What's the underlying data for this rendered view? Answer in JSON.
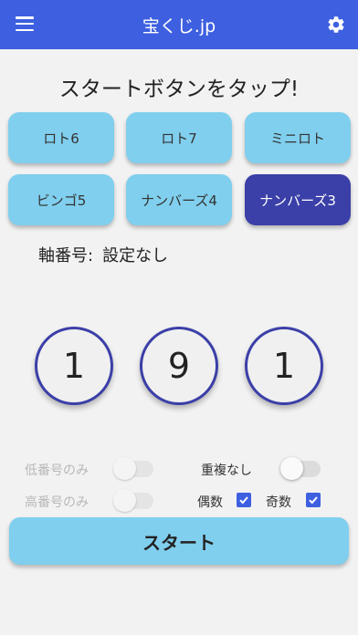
{
  "appbar": {
    "title": "宝くじ.jp",
    "menu_icon": "menu-icon",
    "settings_icon": "gear-icon",
    "color": "#3d5fe0"
  },
  "heading": "スタートボタンをタップ!",
  "games": [
    {
      "label": "ロト6",
      "selected": false
    },
    {
      "label": "ロト7",
      "selected": false
    },
    {
      "label": "ミニロト",
      "selected": false
    },
    {
      "label": "ビンゴ5",
      "selected": false
    },
    {
      "label": "ナンバーズ4",
      "selected": false
    },
    {
      "label": "ナンバーズ3",
      "selected": true
    }
  ],
  "axis": {
    "label": "軸番号:",
    "value": "設定なし"
  },
  "balls": [
    "1",
    "9",
    "1"
  ],
  "options": {
    "low_only": {
      "label": "低番号のみ",
      "on": false,
      "enabled": false
    },
    "high_only": {
      "label": "高番号のみ",
      "on": false,
      "enabled": false
    },
    "no_dup": {
      "label": "重複なし",
      "on": false,
      "enabled": true
    },
    "even": {
      "label": "偶数",
      "checked": true
    },
    "odd": {
      "label": "奇数",
      "checked": true
    }
  },
  "start_label": "スタート",
  "colors": {
    "accent": "#3d5fe0",
    "button": "#80cfee",
    "selected": "#3b3fa8"
  }
}
